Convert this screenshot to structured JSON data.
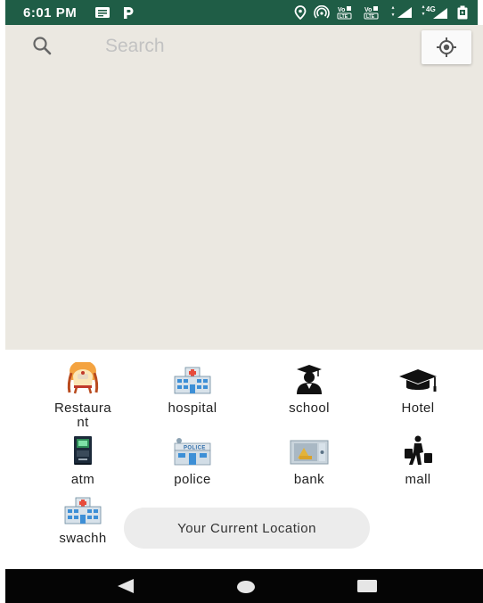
{
  "status_bar": {
    "time": "6:01 PM",
    "left_icons": [
      "message-icon",
      "parking-icon"
    ],
    "right_icons": [
      "location-icon",
      "hotspot-icon",
      "volte-icon",
      "volte-icon",
      "signal-icon",
      "4g-icon",
      "battery-icon"
    ],
    "network_label": "4G",
    "volte_label": "VoLTE",
    "background": "#1f5d46"
  },
  "search": {
    "placeholder": "Search"
  },
  "categories": [
    {
      "label": "Restaura\nnt",
      "icon": "restaurant-icon"
    },
    {
      "label": "hospital",
      "icon": "hospital-icon"
    },
    {
      "label": "school",
      "icon": "graduate-icon"
    },
    {
      "label": "Hotel",
      "icon": "mortarboard-icon"
    },
    {
      "label": "atm",
      "icon": "atm-icon"
    },
    {
      "label": "police",
      "icon": "police-station-icon"
    },
    {
      "label": "bank",
      "icon": "bank-vault-icon"
    },
    {
      "label": "mall",
      "icon": "shopper-icon"
    },
    {
      "label": "swachh",
      "icon": "hospital-icon"
    }
  ],
  "toast": {
    "text": "Your Current Location"
  },
  "police_sign": "POLICE",
  "navigation": [
    "back-icon",
    "home-icon",
    "recents-icon"
  ],
  "colors": {
    "map_background": "#ebe8e1",
    "nav_background": "#050505"
  }
}
